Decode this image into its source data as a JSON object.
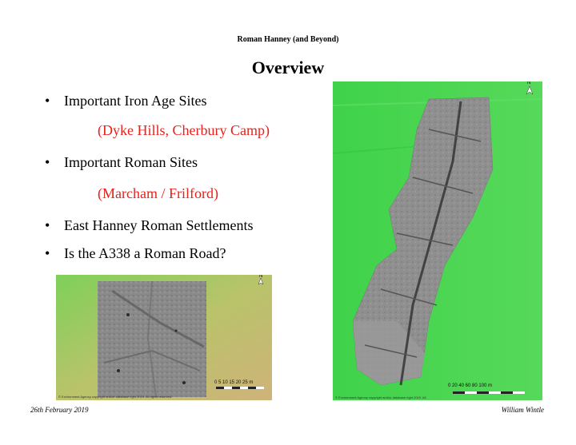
{
  "header": {
    "text": "Roman Hanney (and Beyond)"
  },
  "slide": {
    "title": "Overview"
  },
  "bullets": [
    {
      "text": "Important Iron Age Sites",
      "sub": "(Dyke Hills, Cherbury Camp)"
    },
    {
      "text": "Important Roman Sites",
      "sub": "(Marcham / Frilford)"
    },
    {
      "text": "East Hanney Roman Settlements"
    },
    {
      "text": "Is the A338 a Roman Road?"
    }
  ],
  "colors": {
    "sub_text": "#e8211a",
    "green_map": "#4cd44a",
    "survey_grey": "#8e8e8e"
  },
  "maps": {
    "small": {
      "north": "N",
      "caption": "© Environment Agency copyright and/or database right 2019. All rights reserved.",
      "scale": "0 5 10 15 20 25 m"
    },
    "large": {
      "north": "N",
      "caption": "© Environment Agency copyright and/or database right 2019. All",
      "scale": "0 20 40 60 80 100 m"
    }
  },
  "footer": {
    "left": "26th February 2019",
    "right": "William Wintle"
  }
}
